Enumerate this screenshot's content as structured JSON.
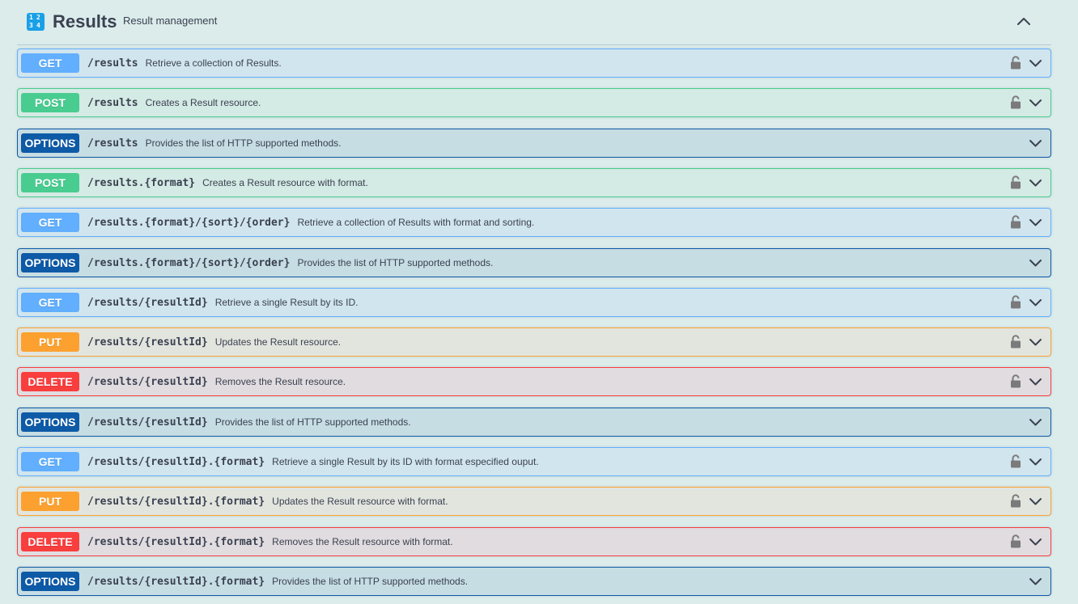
{
  "tag": {
    "name": "Results",
    "description": "Result management",
    "icon": "numbers-grid-icon",
    "icon_digits": [
      "1",
      "2",
      "3",
      "4"
    ]
  },
  "colors": {
    "GET": {
      "badge": "#61affe",
      "bg": "#d1e5ee",
      "border": "#61affe"
    },
    "POST": {
      "badge": "#49cc90",
      "bg": "#d4eae4",
      "border": "#49cc90"
    },
    "PUT": {
      "badge": "#fca130",
      "bg": "#e2e5de",
      "border": "#fca130"
    },
    "DELETE": {
      "badge": "#f93e3e",
      "bg": "#e0dcdf",
      "border": "#f93e3e"
    },
    "OPTIONS": {
      "badge": "#0d5aa7",
      "bg": "#c6dde3",
      "border": "#0d5aa7"
    }
  },
  "operations": [
    {
      "method": "GET",
      "path": "/results",
      "summary": "Retrieve a collection of Results.",
      "locked": true
    },
    {
      "method": "POST",
      "path": "/results",
      "summary": "Creates a Result resource.",
      "locked": true
    },
    {
      "method": "OPTIONS",
      "path": "/results",
      "summary": "Provides the list of HTTP supported methods.",
      "locked": false
    },
    {
      "method": "POST",
      "path": "/results.{format}",
      "summary": "Creates a Result resource with format.",
      "locked": true
    },
    {
      "method": "GET",
      "path": "/results.{format}/{sort}/{order}",
      "summary": "Retrieve a collection of Results with format and sorting.",
      "locked": true
    },
    {
      "method": "OPTIONS",
      "path": "/results.{format}/{sort}/{order}",
      "summary": "Provides the list of HTTP supported methods.",
      "locked": false
    },
    {
      "method": "GET",
      "path": "/results/{resultId}",
      "summary": "Retrieve a single Result by its ID.",
      "locked": true
    },
    {
      "method": "PUT",
      "path": "/results/{resultId}",
      "summary": "Updates the Result resource.",
      "locked": true
    },
    {
      "method": "DELETE",
      "path": "/results/{resultId}",
      "summary": "Removes the Result resource.",
      "locked": true
    },
    {
      "method": "OPTIONS",
      "path": "/results/{resultId}",
      "summary": "Provides the list of HTTP supported methods.",
      "locked": false
    },
    {
      "method": "GET",
      "path": "/results/{resultId}.{format}",
      "summary": "Retrieve a single Result by its ID with format especified ouput.",
      "locked": true
    },
    {
      "method": "PUT",
      "path": "/results/{resultId}.{format}",
      "summary": "Updates the Result resource with format.",
      "locked": true
    },
    {
      "method": "DELETE",
      "path": "/results/{resultId}.{format}",
      "summary": "Removes the Result resource with format.",
      "locked": true
    },
    {
      "method": "OPTIONS",
      "path": "/results/{resultId}.{format}",
      "summary": "Provides the list of HTTP supported methods.",
      "locked": false
    }
  ]
}
